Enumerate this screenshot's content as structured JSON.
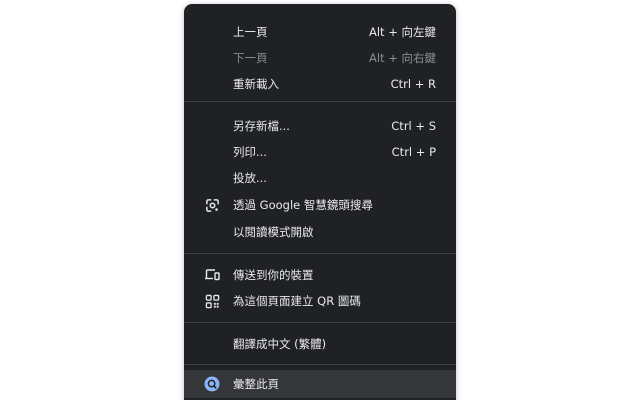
{
  "context_menu": {
    "items": [
      {
        "label": "上一頁",
        "shortcut": "Alt + 向左鍵"
      },
      {
        "label": "下一頁",
        "shortcut": "Alt + 向右鍵"
      },
      {
        "label": "重新載入",
        "shortcut": "Ctrl + R"
      },
      {
        "label": "另存新檔...",
        "shortcut": "Ctrl + S"
      },
      {
        "label": "列印...",
        "shortcut": "Ctrl + P"
      },
      {
        "label": "投放..."
      },
      {
        "label": "透過 Google 智慧鏡頭搜尋",
        "icon": "google-lens-icon"
      },
      {
        "label": "以閱讀模式開啟"
      },
      {
        "label": "傳送到你的裝置",
        "icon": "devices-icon"
      },
      {
        "label": "為這個頁面建立 QR 圖碼",
        "icon": "qr-code-icon"
      },
      {
        "label": "翻譯成中文 (繁體)"
      },
      {
        "label": "彙整此頁",
        "icon": "summarize-icon"
      }
    ]
  },
  "colors": {
    "menu_background": "#202124",
    "text": "#e8eaed",
    "disabled_text": "#8a8d91",
    "separator": "#3c4043",
    "highlight": "#35363a",
    "accent_blue": "#8ab4f8"
  }
}
